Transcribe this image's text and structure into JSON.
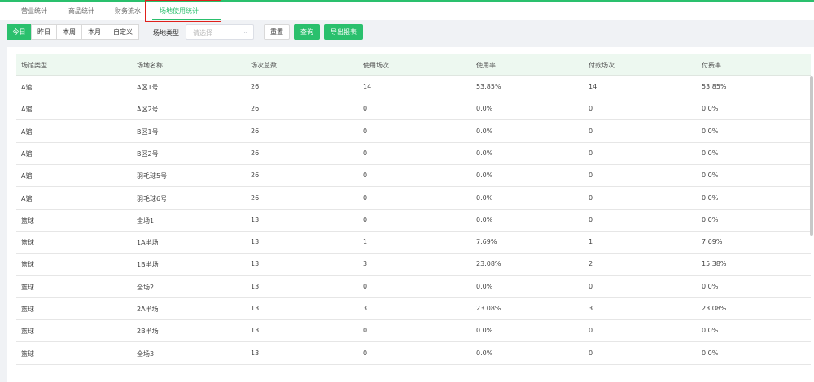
{
  "tabs": [
    {
      "label": "营业统计"
    },
    {
      "label": "商品统计"
    },
    {
      "label": "财务流水"
    },
    {
      "label": "场地使用统计"
    }
  ],
  "filters": {
    "range_buttons": [
      "今日",
      "昨日",
      "本周",
      "本月",
      "自定义"
    ],
    "venue_type_label": "场地类型",
    "venue_type_placeholder": "请选择",
    "reset_label": "重置",
    "search_label": "查询",
    "export_label": "导出报表"
  },
  "table": {
    "headers": [
      "场馆类型",
      "场地名称",
      "场次总数",
      "使用场次",
      "使用率",
      "付款场次",
      "付费率"
    ],
    "rows": [
      [
        "A馆",
        "A区1号",
        "26",
        "14",
        "53.85%",
        "14",
        "53.85%"
      ],
      [
        "A馆",
        "A区2号",
        "26",
        "0",
        "0.0%",
        "0",
        "0.0%"
      ],
      [
        "A馆",
        "B区1号",
        "26",
        "0",
        "0.0%",
        "0",
        "0.0%"
      ],
      [
        "A馆",
        "B区2号",
        "26",
        "0",
        "0.0%",
        "0",
        "0.0%"
      ],
      [
        "A馆",
        "羽毛球5号",
        "26",
        "0",
        "0.0%",
        "0",
        "0.0%"
      ],
      [
        "A馆",
        "羽毛球6号",
        "26",
        "0",
        "0.0%",
        "0",
        "0.0%"
      ],
      [
        "篮球",
        "全场1",
        "13",
        "0",
        "0.0%",
        "0",
        "0.0%"
      ],
      [
        "篮球",
        "1A半场",
        "13",
        "1",
        "7.69%",
        "1",
        "7.69%"
      ],
      [
        "篮球",
        "1B半场",
        "13",
        "3",
        "23.08%",
        "2",
        "15.38%"
      ],
      [
        "篮球",
        "全场2",
        "13",
        "0",
        "0.0%",
        "0",
        "0.0%"
      ],
      [
        "篮球",
        "2A半场",
        "13",
        "3",
        "23.08%",
        "3",
        "23.08%"
      ],
      [
        "篮球",
        "2B半场",
        "13",
        "0",
        "0.0%",
        "0",
        "0.0%"
      ],
      [
        "篮球",
        "全场3",
        "13",
        "0",
        "0.0%",
        "0",
        "0.0%"
      ]
    ]
  },
  "colors": {
    "accent": "#2ac06d",
    "highlight_border": "#e0201b"
  }
}
